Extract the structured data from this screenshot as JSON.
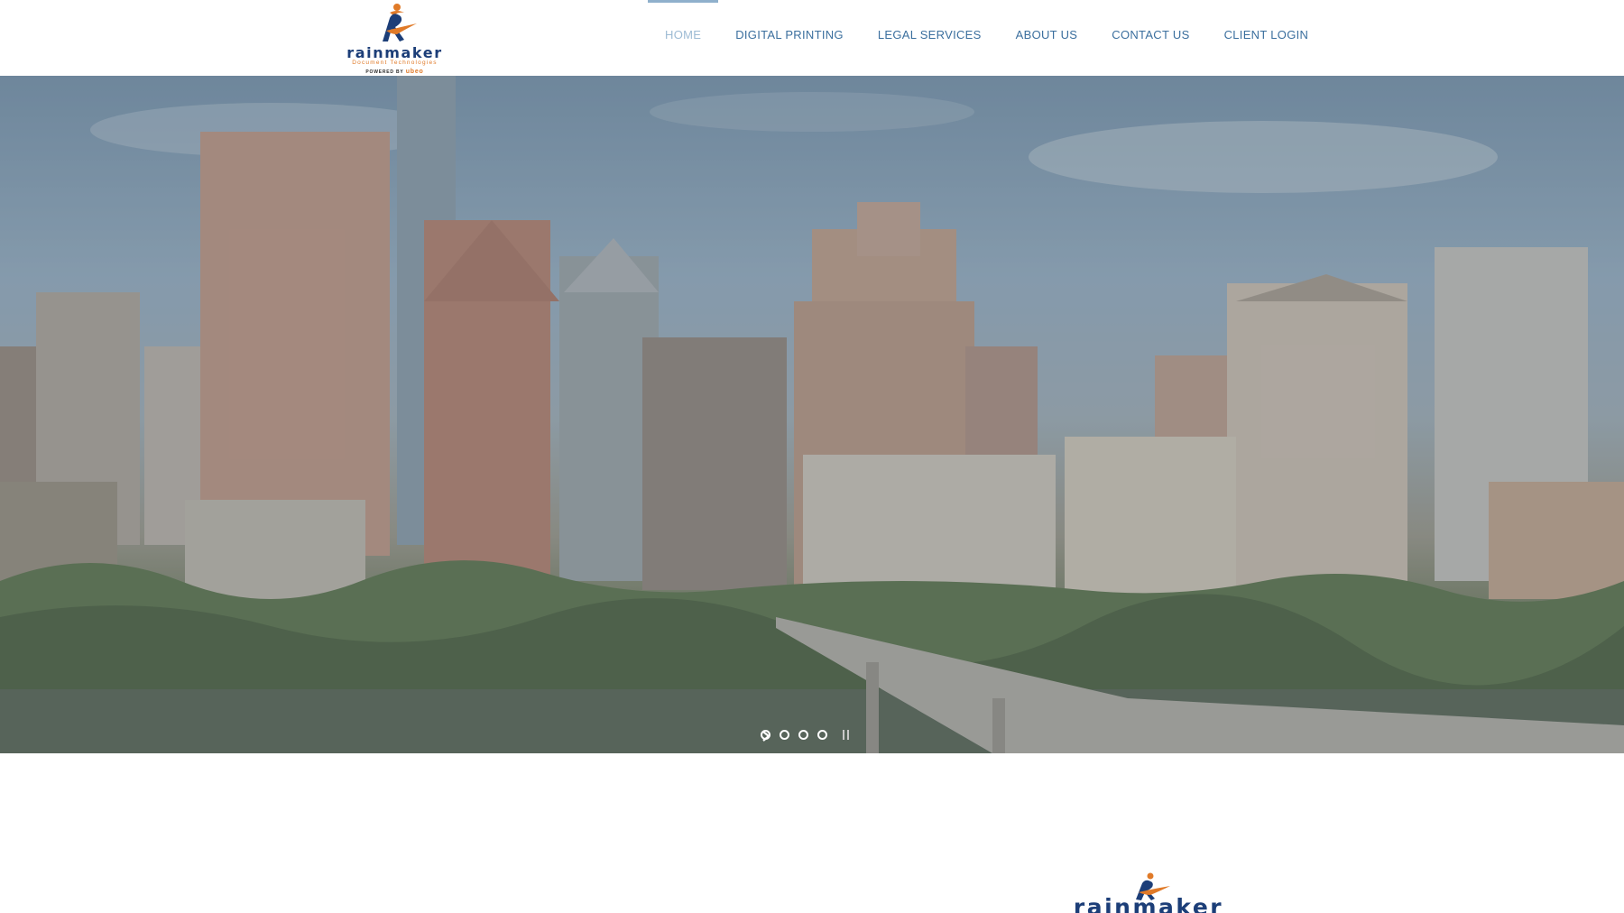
{
  "brand": {
    "name": "rainmaker",
    "tagline": "Document Technologies",
    "powered_by": "POWERED BY",
    "powered_brand": "ubeo",
    "colors": {
      "navy": "#1c3e78",
      "orange": "#e07a28",
      "nav": "#3b6f9e",
      "nav_active": "#9dbbd4"
    }
  },
  "nav": {
    "items": [
      {
        "label": "HOME",
        "active": true
      },
      {
        "label": "DIGITAL PRINTING",
        "active": false
      },
      {
        "label": "LEGAL SERVICES",
        "active": false
      },
      {
        "label": "ABOUT US",
        "active": false
      },
      {
        "label": "CONTACT US",
        "active": false
      },
      {
        "label": "CLIENT LOGIN",
        "active": false
      }
    ]
  },
  "hero": {
    "slides_count": 4,
    "icons": {
      "next": "chevron-right-icon",
      "pause": "pause-icon"
    }
  }
}
